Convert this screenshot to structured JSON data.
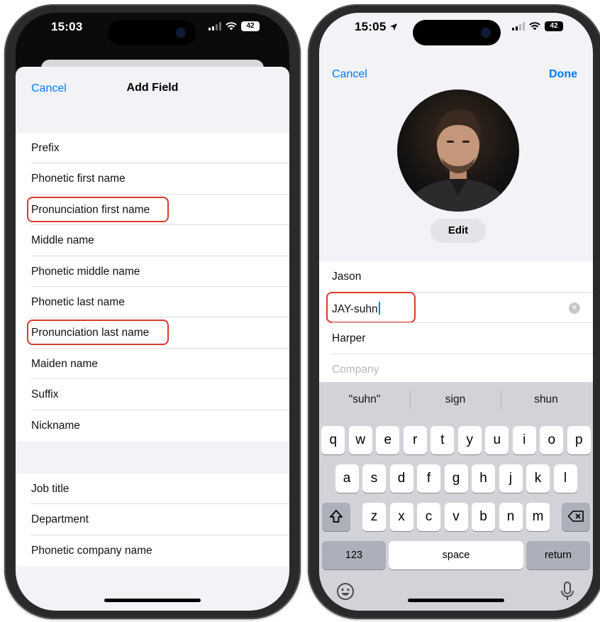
{
  "left_phone": {
    "status_bar": {
      "time": "15:03",
      "battery": "42"
    },
    "nav": {
      "cancel_label": "Cancel",
      "title": "Add Field"
    },
    "name_fields": [
      {
        "label": "Prefix",
        "highlighted": false
      },
      {
        "label": "Phonetic first name",
        "highlighted": false
      },
      {
        "label": "Pronunciation first name",
        "highlighted": true
      },
      {
        "label": "Middle name",
        "highlighted": false
      },
      {
        "label": "Phonetic middle name",
        "highlighted": false
      },
      {
        "label": "Phonetic last name",
        "highlighted": false
      },
      {
        "label": "Pronunciation last name",
        "highlighted": true
      },
      {
        "label": "Maiden name",
        "highlighted": false
      },
      {
        "label": "Suffix",
        "highlighted": false
      },
      {
        "label": "Nickname",
        "highlighted": false
      }
    ],
    "work_fields": [
      {
        "label": "Job title"
      },
      {
        "label": "Department"
      },
      {
        "label": "Phonetic company name"
      }
    ]
  },
  "right_phone": {
    "status_bar": {
      "time": "15:05",
      "battery": "42",
      "location_icon": "location-arrow-icon"
    },
    "nav": {
      "cancel_label": "Cancel",
      "done_label": "Done"
    },
    "photo": {
      "edit_label": "Edit"
    },
    "fields": [
      {
        "value": "Jason",
        "placeholder": false
      },
      {
        "value": "JAY-suhn",
        "placeholder": false,
        "highlighted": true,
        "focused": true
      },
      {
        "value": "Harper",
        "placeholder": false
      },
      {
        "value": "Company",
        "placeholder": true
      }
    ],
    "keyboard": {
      "suggestions": [
        "\"suhn\"",
        "sign",
        "shun"
      ],
      "row1": [
        "q",
        "w",
        "e",
        "r",
        "t",
        "y",
        "u",
        "i",
        "o",
        "p"
      ],
      "row2": [
        "a",
        "s",
        "d",
        "f",
        "g",
        "h",
        "j",
        "k",
        "l"
      ],
      "row3": [
        "z",
        "x",
        "c",
        "v",
        "b",
        "n",
        "m"
      ],
      "numbers_label": "123",
      "space_label": "space",
      "return_label": "return"
    }
  },
  "colors": {
    "accent": "#007aff",
    "highlight_border": "#d93a2b",
    "grouped_background": "#f2f2f7",
    "keyboard_background": "#d1d3d9"
  }
}
